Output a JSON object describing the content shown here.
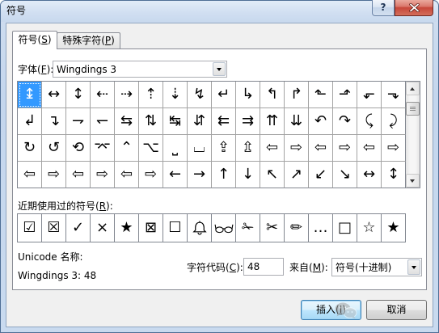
{
  "window": {
    "title": "符号",
    "help_label": "?"
  },
  "tabs": [
    {
      "label": "符号(S)",
      "selected": true
    },
    {
      "label": "特殊字符(P)",
      "selected": false
    }
  ],
  "font": {
    "label": "字体(F):",
    "value": "Wingdings 3"
  },
  "symbol_grid": {
    "selected_index": 0,
    "scroll_fraction": 0.1,
    "rows": [
      [
        "↨",
        "↔",
        "↕",
        "⇠",
        "⇢",
        "⇡",
        "⇣",
        "↯",
        "↵",
        "↳",
        "↰",
        "↱",
        "⬑",
        "⬏",
        "⬐",
        "⬎"
      ],
      [
        "↲",
        "↴",
        "⇁",
        "↽",
        "⇆",
        "⇅",
        "↹",
        "⇵",
        "⇇",
        "⇉",
        "⇈",
        "⇊",
        "↶",
        "↷",
        "⤹",
        "⤸"
      ],
      [
        "↻",
        "↺",
        "⟲",
        "⌤",
        "⌃",
        "⌥",
        "⎵",
        "⌴",
        "⇪",
        "⇫",
        "⇦",
        "⇨",
        "⇦",
        "⇨",
        "⇦",
        "⇨"
      ],
      [
        "⇦",
        "⇨",
        "⇦",
        "⇨",
        "⇦",
        "⇨",
        "←",
        "→",
        "↑",
        "↓",
        "↖",
        "↗",
        "↙",
        "↘",
        "↔",
        "↕"
      ]
    ]
  },
  "recent": {
    "label": "近期使用过的符号(R):",
    "items": [
      {
        "glyph": "☑"
      },
      {
        "glyph": "☒"
      },
      {
        "glyph": "✓"
      },
      {
        "glyph": "×"
      },
      {
        "glyph": "★"
      },
      {
        "glyph": "⊠"
      },
      {
        "glyph": "☐"
      },
      {
        "icon": "bell-icon"
      },
      {
        "icon": "glasses-icon"
      },
      {
        "glyph": "✁"
      },
      {
        "glyph": "✂"
      },
      {
        "glyph": "✏"
      },
      {
        "glyph": "…"
      },
      {
        "glyph": "□"
      },
      {
        "glyph": "☆"
      },
      {
        "glyph": "★"
      }
    ]
  },
  "unicode_name": {
    "label": "Unicode 名称:",
    "value": "Wingdings 3: 48"
  },
  "char_code": {
    "label": "字符代码(C):",
    "value": "48"
  },
  "from": {
    "label": "来自(M):",
    "value": "符号(十进制)"
  },
  "buttons": {
    "insert": "插入(I)",
    "cancel": "取消"
  },
  "colors": {
    "selection": "#3399ff",
    "close_button": "#c7473a",
    "title_bar": "#cddcef",
    "focus_border": "#3c7fb1"
  }
}
